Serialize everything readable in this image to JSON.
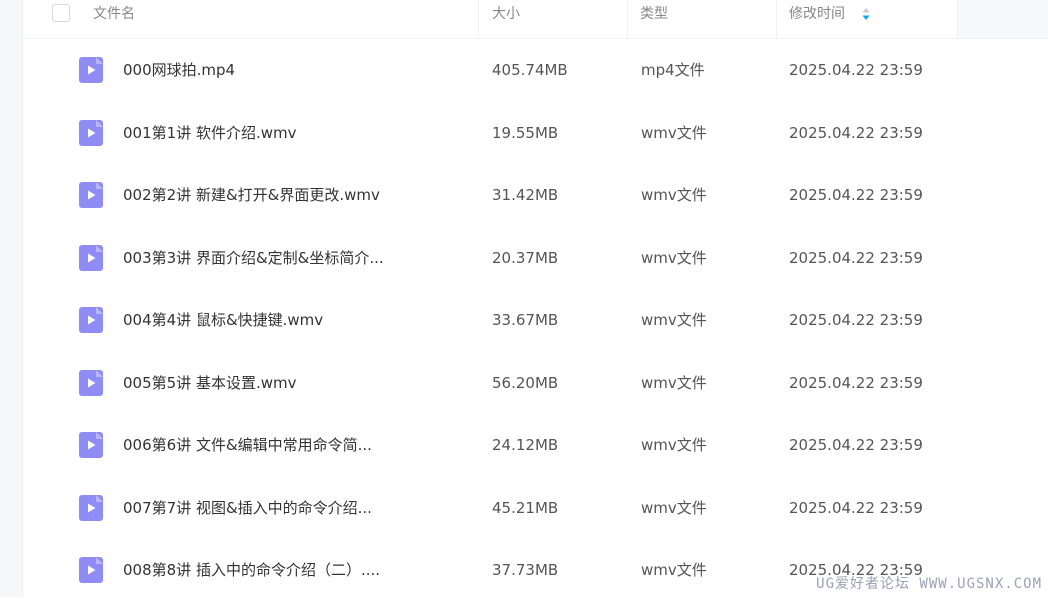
{
  "header": {
    "name_label": "文件名",
    "size_label": "大小",
    "type_label": "类型",
    "date_label": "修改时间"
  },
  "files": [
    {
      "name": "000网球拍.mp4",
      "size": "405.74MB",
      "type": "mp4文件",
      "date": "2025.04.22 23:59"
    },
    {
      "name": "001第1讲 软件介绍.wmv",
      "size": "19.55MB",
      "type": "wmv文件",
      "date": "2025.04.22 23:59"
    },
    {
      "name": "002第2讲 新建&打开&界面更改.wmv",
      "size": "31.42MB",
      "type": "wmv文件",
      "date": "2025.04.22 23:59"
    },
    {
      "name": "003第3讲 界面介绍&定制&坐标简介...",
      "size": "20.37MB",
      "type": "wmv文件",
      "date": "2025.04.22 23:59"
    },
    {
      "name": "004第4讲 鼠标&快捷键.wmv",
      "size": "33.67MB",
      "type": "wmv文件",
      "date": "2025.04.22 23:59"
    },
    {
      "name": "005第5讲 基本设置.wmv",
      "size": "56.20MB",
      "type": "wmv文件",
      "date": "2025.04.22 23:59"
    },
    {
      "name": "006第6讲 文件&编辑中常用命令简...",
      "size": "24.12MB",
      "type": "wmv文件",
      "date": "2025.04.22 23:59"
    },
    {
      "name": "007第7讲 视图&插入中的命令介绍...",
      "size": "45.21MB",
      "type": "wmv文件",
      "date": "2025.04.22 23:59"
    },
    {
      "name": "008第8讲 插入中的命令介绍（二）....",
      "size": "37.73MB",
      "type": "wmv文件",
      "date": "2025.04.22 23:59"
    }
  ],
  "icons": {
    "file_icon": "video-file-icon",
    "sort_icon": "sort-icon"
  },
  "colors": {
    "video_icon": "#8f8cf5",
    "sort_active": "#06a7ff"
  },
  "watermark": "UG爱好者论坛 WWW.UGSNX.COM"
}
